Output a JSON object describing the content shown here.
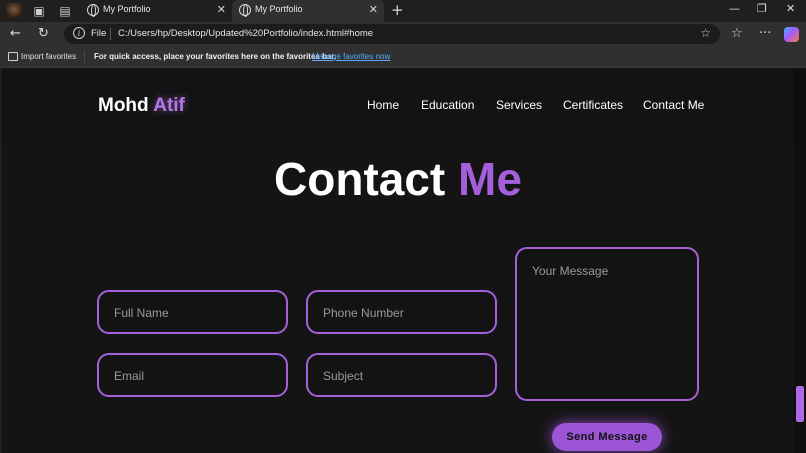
{
  "browser": {
    "tabs": [
      {
        "title": "My Portfolio",
        "active": false
      },
      {
        "title": "My Portfolio",
        "active": true
      }
    ],
    "icons": {
      "workspaces": "▣",
      "tab_actions": "▤",
      "new_tab": "+",
      "minimize": "—",
      "restore": "❐",
      "close": "✕",
      "tab_close": "✕",
      "back": "←",
      "refresh": "↻",
      "info": "i",
      "star": "☆",
      "favorites": "☆",
      "more": "···"
    },
    "address": {
      "scheme_label": "File",
      "url": "C:/Users/hp/Desktop/Updated%20Portfolio/index.html#home"
    },
    "favorites_bar": {
      "import_label": "Import favorites",
      "message": "For quick access, place your favorites here on the favorites bar.",
      "link": "Manage favorites now"
    }
  },
  "site": {
    "logo": {
      "first": "Mohd",
      "accent": "Atif"
    },
    "nav": [
      "Home",
      "Education",
      "Services",
      "Certificates",
      "Contact Me"
    ],
    "heading": {
      "first": "Contact",
      "accent": "Me"
    },
    "form": {
      "full_name": "Full Name",
      "phone": "Phone Number",
      "email": "Email",
      "subject": "Subject",
      "message": "Your Message",
      "submit": "Send Message"
    }
  },
  "colors": {
    "accent": "#a65fdc",
    "page_bg": "#141414",
    "chrome_bg": "#303030"
  }
}
